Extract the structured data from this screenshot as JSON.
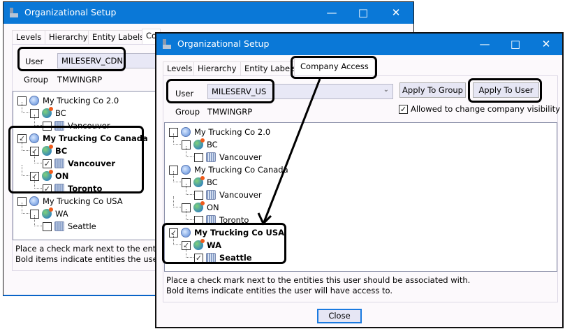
{
  "back_window": {
    "title": "Organizational Setup",
    "tabs": [
      "Levels",
      "Hierarchy",
      "Entity Labels",
      "Co"
    ],
    "user_label": "User",
    "user_value": "MILESERV_CDN",
    "group_label": "Group",
    "group_value": "TMWINGRP",
    "tree": [
      {
        "label": "My Trucking Co 2.0",
        "level": 0,
        "icon": "globe-icon",
        "checked": false,
        "bold": false
      },
      {
        "label": "BC",
        "level": 1,
        "icon": "region-globe-icon",
        "checked": false,
        "bold": false
      },
      {
        "label": "Vancouver",
        "level": 2,
        "icon": "building-icon",
        "checked": false,
        "bold": false
      },
      {
        "label": "My Trucking Co Canada",
        "level": 0,
        "icon": "globe-icon",
        "checked": true,
        "bold": true
      },
      {
        "label": "BC",
        "level": 1,
        "icon": "region-globe-icon",
        "checked": true,
        "bold": true
      },
      {
        "label": "Vancouver",
        "level": 2,
        "icon": "building-icon",
        "checked": true,
        "bold": true
      },
      {
        "label": "ON",
        "level": 1,
        "icon": "region-globe-icon",
        "checked": true,
        "bold": true
      },
      {
        "label": "Toronto",
        "level": 2,
        "icon": "building-icon",
        "checked": true,
        "bold": true
      },
      {
        "label": "My Trucking Co USA",
        "level": 0,
        "icon": "globe-icon",
        "checked": false,
        "bold": false
      },
      {
        "label": "WA",
        "level": 1,
        "icon": "region-globe-icon",
        "checked": false,
        "bold": false
      },
      {
        "label": "Seattle",
        "level": 2,
        "icon": "building-icon",
        "checked": false,
        "bold": false
      }
    ],
    "help_line1": "Place a check mark next to the entities",
    "help_line2": "Bold items indicate entities the user w"
  },
  "front_window": {
    "title": "Organizational Setup",
    "tabs": [
      "Levels",
      "Hierarchy",
      "Entity Labels",
      "Company Access"
    ],
    "active_tab": "Company Access",
    "user_label": "User",
    "user_value": "MILESERV_US",
    "group_label": "Group",
    "group_value": "TMWINGRP",
    "apply_group_label": "Apply To Group",
    "apply_user_label": "Apply To User",
    "allow_visibility_label": "Allowed to change company visibility",
    "allow_visibility_checked": true,
    "tree": [
      {
        "label": "My Trucking Co 2.0",
        "level": 0,
        "icon": "globe-icon",
        "checked": false,
        "bold": false
      },
      {
        "label": "BC",
        "level": 1,
        "icon": "region-globe-icon",
        "checked": false,
        "bold": false
      },
      {
        "label": "Vancouver",
        "level": 2,
        "icon": "building-icon",
        "checked": false,
        "bold": false
      },
      {
        "label": "My Trucking Co Canada",
        "level": 0,
        "icon": "globe-icon",
        "checked": false,
        "bold": false
      },
      {
        "label": "BC",
        "level": 1,
        "icon": "region-globe-icon",
        "checked": false,
        "bold": false
      },
      {
        "label": "Vancouver",
        "level": 2,
        "icon": "building-icon",
        "checked": false,
        "bold": false
      },
      {
        "label": "ON",
        "level": 1,
        "icon": "region-globe-icon",
        "checked": false,
        "bold": false
      },
      {
        "label": "Toronto",
        "level": 2,
        "icon": "building-icon",
        "checked": false,
        "bold": false
      },
      {
        "label": "My Trucking Co USA",
        "level": 0,
        "icon": "globe-icon",
        "checked": true,
        "bold": true
      },
      {
        "label": "WA",
        "level": 1,
        "icon": "region-globe-icon",
        "checked": true,
        "bold": true
      },
      {
        "label": "Seattle",
        "level": 2,
        "icon": "building-icon",
        "checked": true,
        "bold": true
      }
    ],
    "help_line1": "Place a check mark next to the entities this user should be associated with.",
    "help_line2": "Bold items indicate entities the user will have access to.",
    "close_label": "Close"
  },
  "colors": {
    "titlebar": "#0a78d7",
    "annotation": "#000000"
  }
}
